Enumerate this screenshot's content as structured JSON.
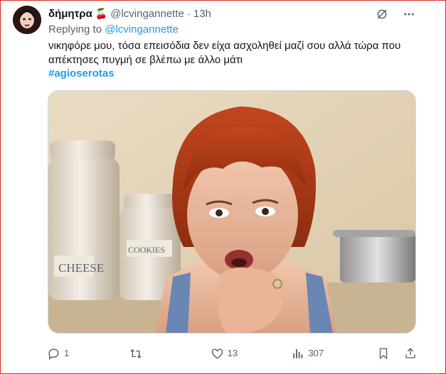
{
  "tweet": {
    "display_name": "δήμητρα",
    "name_emoji": "🍒",
    "handle": "@lcvingannette",
    "separator": "·",
    "time": "13h",
    "replying_prefix": "Replying to",
    "replying_handle": "@lcvingannette",
    "text": "νικηφόρε μου, τόσα επεισόδια δεν είχα ασχοληθεί μαζί σου αλλά τώρα που απέκτησες πυγμή σε βλέπω με άλλο μάτι",
    "hashtag": "#agioserotas"
  },
  "actions": {
    "reply_count": "1",
    "retweet_count": "",
    "like_count": "13",
    "view_count": "307"
  },
  "icons": {
    "header": [
      "grok-icon",
      "more-icon"
    ],
    "actions": [
      "reply-icon",
      "retweet-icon",
      "like-icon",
      "views-icon",
      "bookmark-icon",
      "share-icon"
    ]
  },
  "media": {
    "jar_labels": [
      "CHEESE",
      "COOKIES"
    ]
  }
}
